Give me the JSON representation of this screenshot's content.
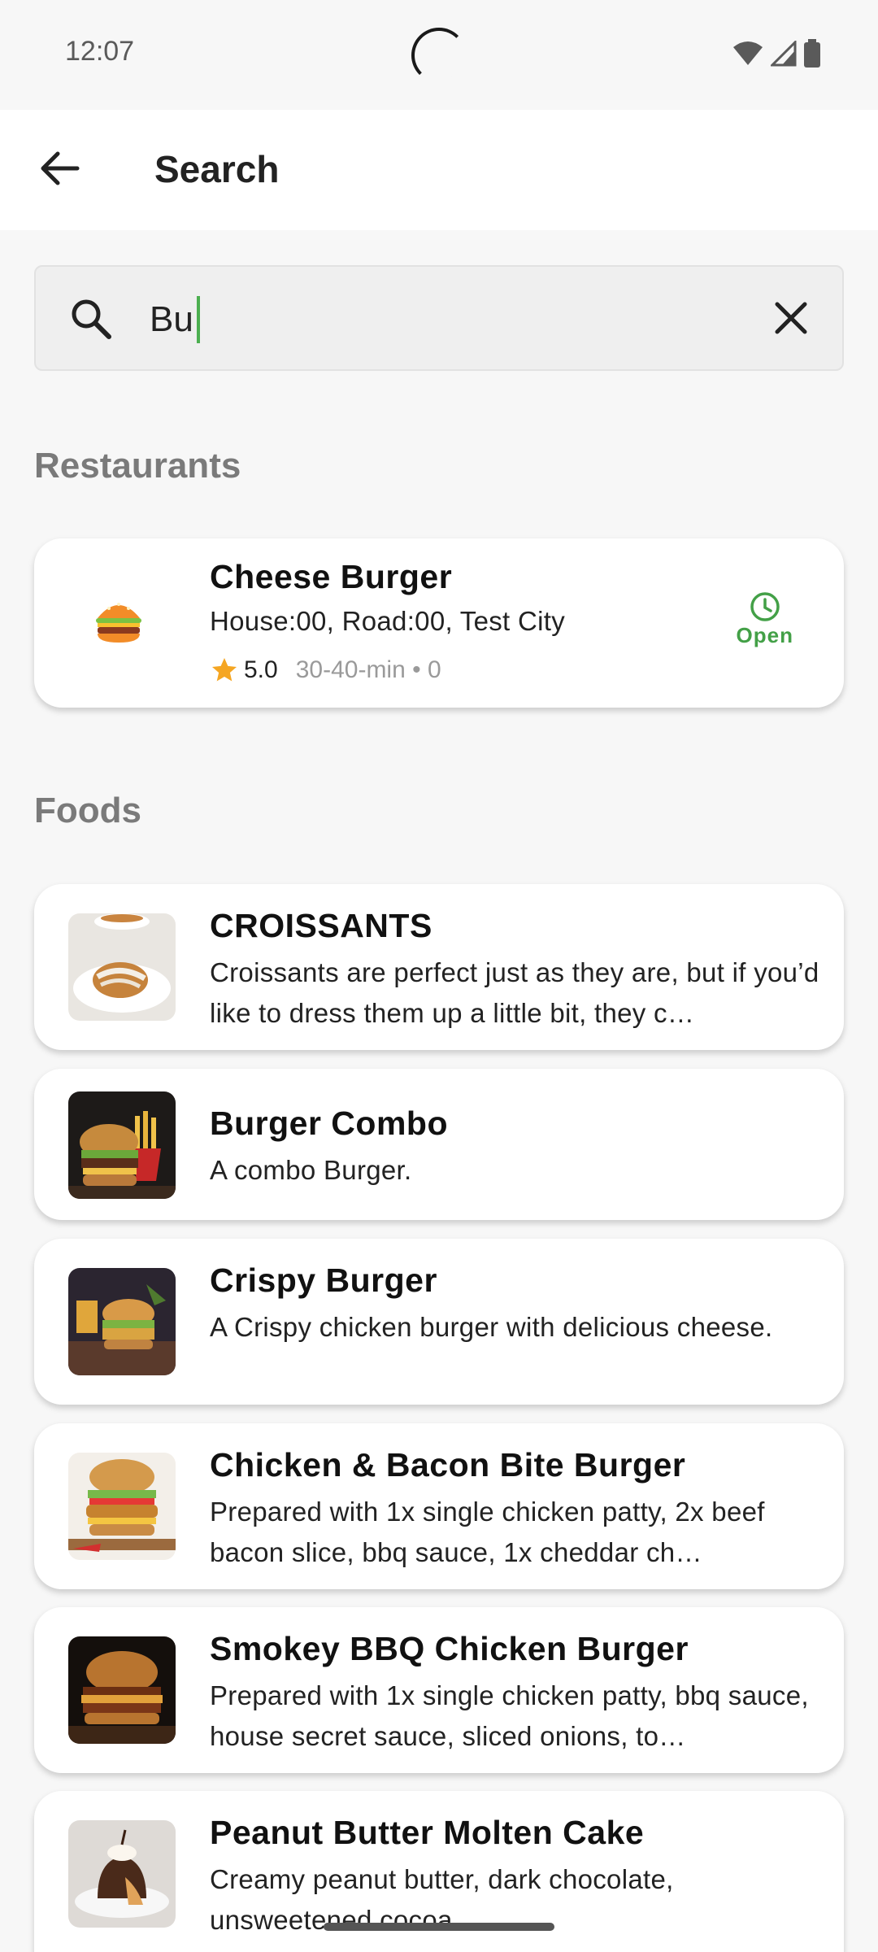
{
  "status_bar": {
    "time": "12:07"
  },
  "app_bar": {
    "title": "Search"
  },
  "search": {
    "value": "Bu"
  },
  "sections": {
    "restaurants": "Restaurants",
    "foods": "Foods"
  },
  "restaurant": {
    "name": "Cheese Burger",
    "address": "House:00, Road:00, Test City",
    "rating": "5.0",
    "meta": "30-40-min • 0",
    "status": "Open"
  },
  "foods": [
    {
      "name": "CROISSANTS",
      "desc": "Croissants are perfect just as they are, but if you’d like to dress them up a little bit, they c…"
    },
    {
      "name": "Burger Combo",
      "desc": "A combo Burger."
    },
    {
      "name": "Crispy Burger",
      "desc": "A Crispy chicken burger with delicious cheese."
    },
    {
      "name": "Chicken & Bacon Bite Burger",
      "desc": "Prepared with 1x single chicken patty, 2x beef bacon slice, bbq sauce, 1x cheddar ch…"
    },
    {
      "name": "Smokey BBQ Chicken Burger",
      "desc": "Prepared with 1x single chicken patty, bbq sauce, house secret sauce, sliced onions, to…"
    },
    {
      "name": "Peanut Butter Molten Cake",
      "desc": "Creamy peanut butter, dark chocolate, unsweetened cocoa"
    }
  ],
  "colors": {
    "accent": "#43a047",
    "star": "#f5a623",
    "card": "#ffffff",
    "background": "#f7f7f7"
  }
}
